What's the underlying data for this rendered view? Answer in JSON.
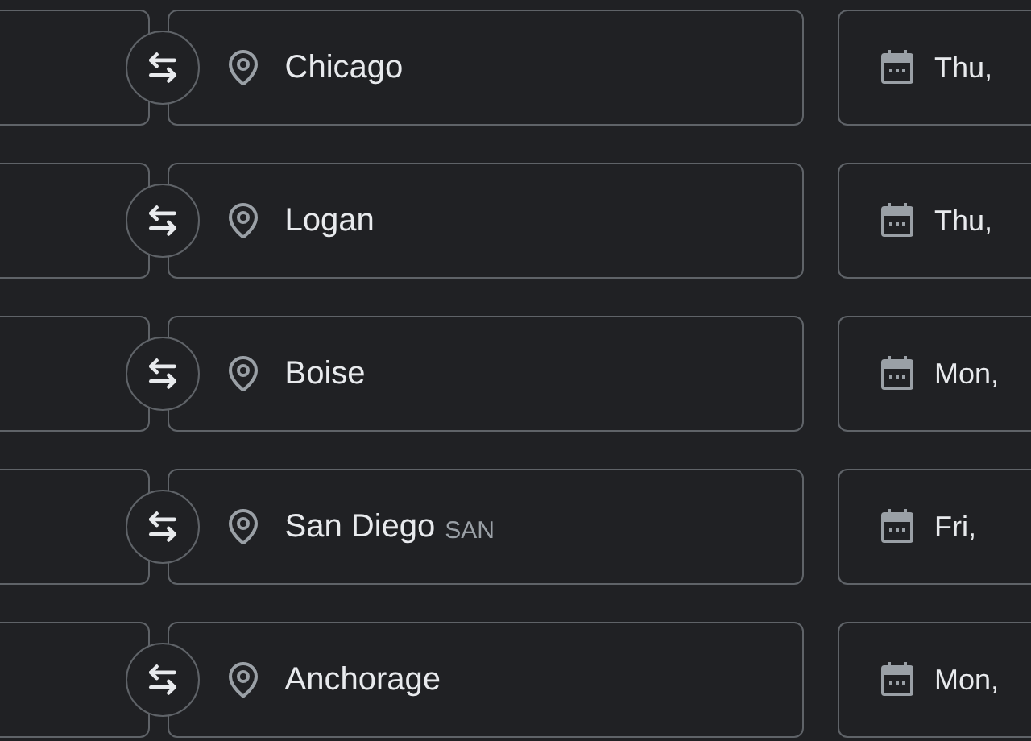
{
  "trips": [
    {
      "destination": "Chicago",
      "date": "Thu,"
    },
    {
      "destination": "Logan",
      "date": "Thu,"
    },
    {
      "destination": "Boise",
      "date": "Mon,"
    },
    {
      "destination": "San Diego",
      "code": "SAN",
      "date": "Fri,"
    },
    {
      "destination": "Anchorage",
      "date": "Mon,"
    }
  ]
}
